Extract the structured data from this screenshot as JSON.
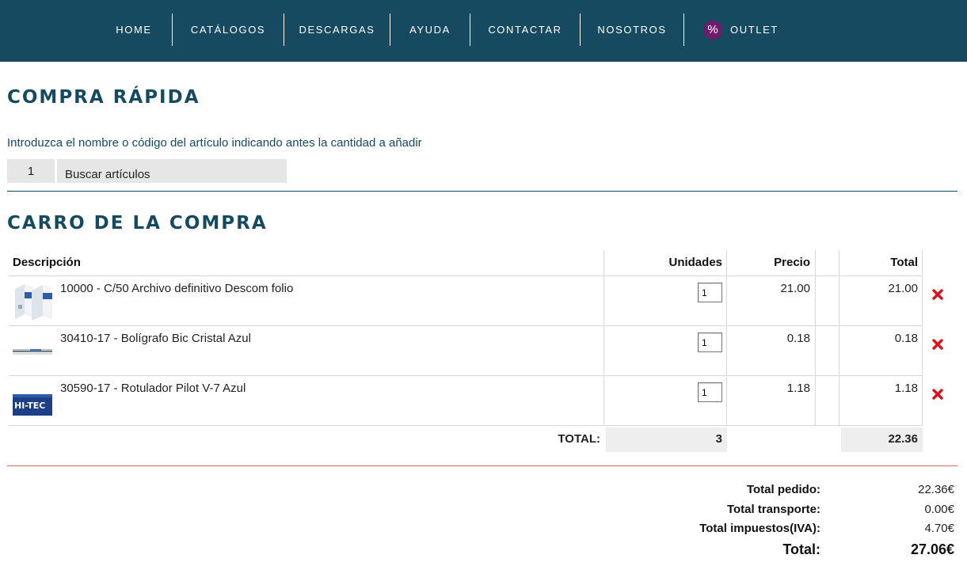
{
  "nav": {
    "items": [
      "HOME",
      "CATÁLOGOS",
      "DESCARGAS",
      "AYUDA",
      "CONTACTAR",
      "NOSOTROS"
    ],
    "outlet_badge": "%",
    "outlet_label": "OUTLET"
  },
  "quick": {
    "title": "COMPRA RÁPIDA",
    "instructions": "Introduzca el nombre o código del artículo indicando antes la cantidad a añadir",
    "qty_value": "1",
    "search_placeholder": "Buscar artículos"
  },
  "cart": {
    "title": "CARRO DE LA COMPRA",
    "columns": {
      "description": "Descripción",
      "units": "Unidades",
      "price": "Precio",
      "total": "Total"
    },
    "items": [
      {
        "description": "10000 - C/50 Archivo definitivo Descom folio",
        "units": "1",
        "price": "21.00",
        "total": "21.00",
        "thumb": "archive-box-image"
      },
      {
        "description": "30410-17 - Bolígrafo Bic Cristal Azul",
        "units": "1",
        "price": "0.18",
        "total": "0.18",
        "thumb": "pen-image"
      },
      {
        "description": "30590-17 - Rotulador Pilot V-7 Azul",
        "units": "1",
        "price": "1.18",
        "total": "1.18",
        "thumb": "marker-image"
      }
    ],
    "totals_label": "TOTAL:",
    "totals_units": "3",
    "totals_amount": "22.36",
    "remove_icon": "close-x-icon",
    "remove_color": "#e0101a"
  },
  "summary": {
    "order_label": "Total pedido:",
    "order_value": "22.36€",
    "shipping_label": "Total transporte:",
    "shipping_value": "0.00€",
    "tax_label": "Total impuestos(IVA):",
    "tax_value": "4.70€",
    "grand_label": "Total:",
    "grand_value": "27.06€"
  },
  "colors": {
    "brand": "#154a60",
    "outlet": "#6e1c6b",
    "divider_red": "#d86a6a"
  }
}
